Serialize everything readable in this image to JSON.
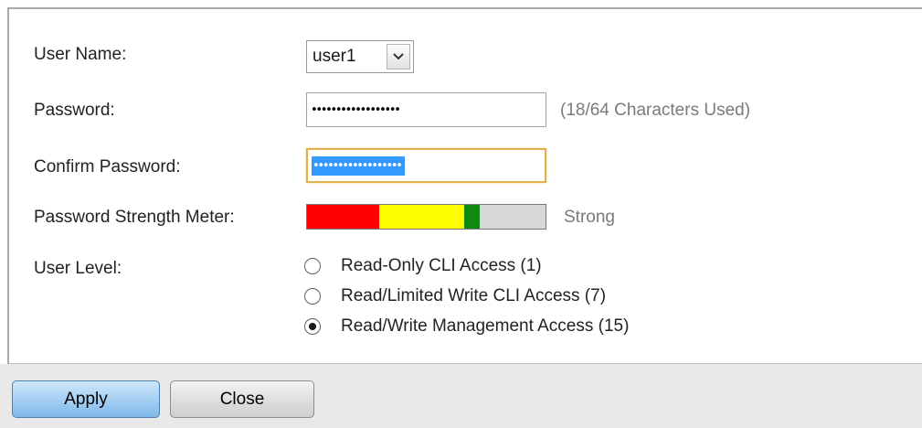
{
  "form": {
    "user_name_label": "User Name:",
    "user_name_value": "user1",
    "password_label": "Password:",
    "password_masked": "••••••••••••••••••",
    "password_hint": "(18/64 Characters Used)",
    "confirm_label": "Confirm Password:",
    "confirm_masked": "••••••••••••••••••",
    "strength_label": "Password Strength Meter:",
    "strength_text": "Strong",
    "strength_colors": [
      "#ff0000",
      "#ffff00",
      "#118811",
      "#d8d8d8"
    ],
    "user_level_label": "User Level:",
    "user_levels": [
      {
        "label": "Read-Only CLI Access (1)",
        "checked": false
      },
      {
        "label": "Read/Limited Write CLI Access (7)",
        "checked": false
      },
      {
        "label": "Read/Write Management Access (15)",
        "checked": true
      }
    ]
  },
  "buttons": {
    "apply_label": "Apply",
    "close_label": "Close"
  },
  "icons": {
    "select_arrow": "chevron-down-icon"
  }
}
